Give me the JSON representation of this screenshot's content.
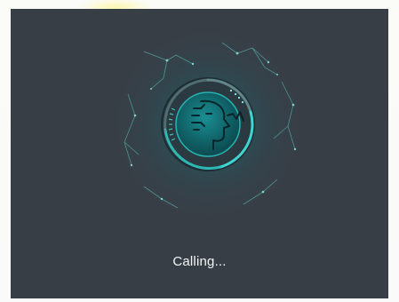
{
  "call": {
    "status_text": "Calling..."
  },
  "icons": {
    "emblem": "face-scan-icon"
  },
  "colors": {
    "panel_background": "#383e46",
    "accent": "#2fd1cf",
    "accent_dark": "#0f6d6e",
    "text": "#f3f5f7"
  }
}
